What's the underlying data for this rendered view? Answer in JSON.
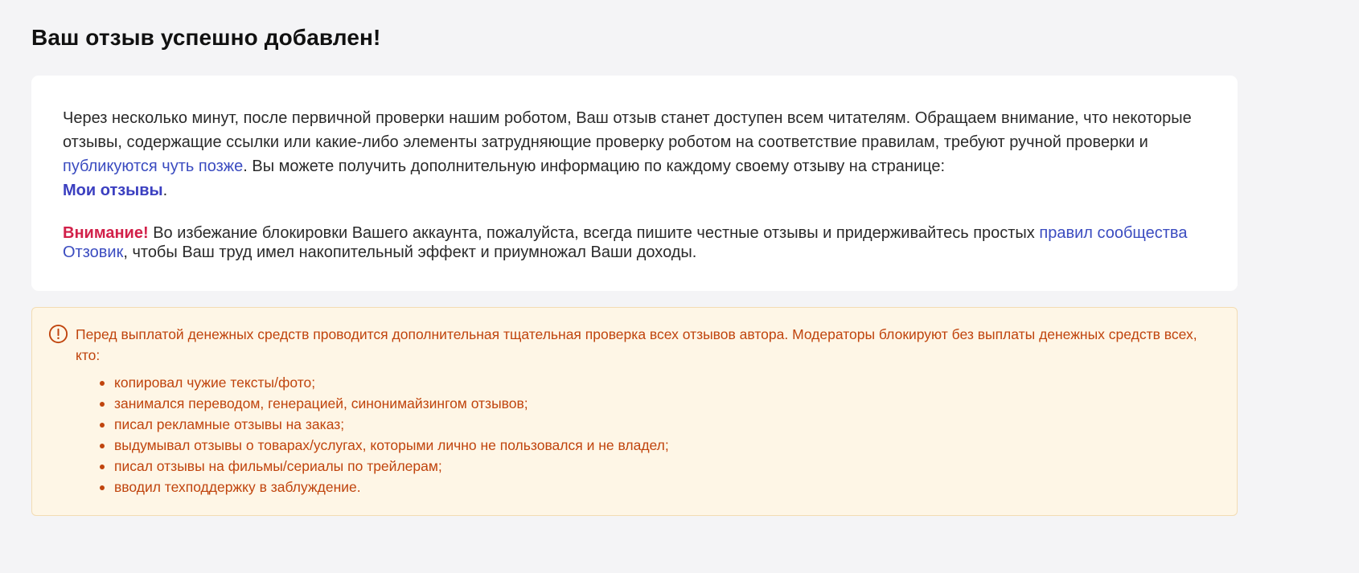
{
  "page": {
    "title": "Ваш отзыв успешно добавлен!"
  },
  "success_card": {
    "para1_part1": "Через несколько минут, после первичной проверки нашим роботом, Ваш отзыв станет доступен всем читателям. Обращаем внимание, что некоторые отзывы, содержащие ссылки или какие-либо элементы затрудняющие проверку роботом на соответствие правилам, требуют ручной проверки и ",
    "para1_link1": "публикуются чуть позже",
    "para1_part2": ". Вы можете получить дополнительную информацию по каждому своему отзыву на странице: ",
    "para1_link2": "Мои отзывы",
    "para1_end": ".",
    "warning_label": "Внимание!",
    "para2_part1": " Во избежание блокировки Вашего аккаунта, пожалуйста, всегда пишите честные отзывы и придерживайтесь простых ",
    "para2_link": "правил сообщества Отзовик",
    "para2_part2": ", чтобы Ваш труд имел накопительный эффект и приумножал Ваши доходы."
  },
  "notice": {
    "icon": "exclamation-circle-icon",
    "text": "Перед выплатой денежных средств проводится дополнительная тщательная проверка всех отзывов автора. Модераторы блокируют без выплаты денежных средств всех, кто:",
    "items": [
      "копировал чужие тексты/фото;",
      "занимался переводом, генерацией, синонимайзингом отзывов;",
      "писал рекламные отзывы на заказ;",
      "выдумывал отзывы о товарах/услугах, которыми лично не пользовался и не владел;",
      "писал отзывы на фильмы/сериалы по трейлерам;",
      "вводил техподдержку в заблуждение."
    ]
  },
  "colors": {
    "background": "#f4f4f6",
    "link": "#3b4cc0",
    "warning_label": "#d2214a",
    "notice_text": "#c0440d",
    "notice_bg": "#fef6e6"
  }
}
